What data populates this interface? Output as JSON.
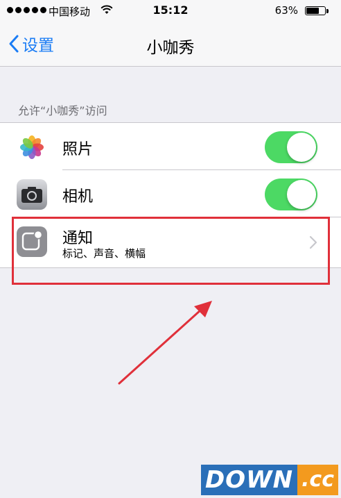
{
  "status_bar": {
    "carrier": "中国移动",
    "time": "15:12",
    "battery_percent": "63%",
    "battery_level": 0.63
  },
  "nav": {
    "back_label": "设置",
    "title": "小咖秀"
  },
  "section": {
    "header": "允许“小咖秀”访问"
  },
  "rows": [
    {
      "label": "照片",
      "toggle_on": true,
      "icon": "photos-icon"
    },
    {
      "label": "相机",
      "toggle_on": true,
      "icon": "camera-icon"
    },
    {
      "label": "通知",
      "subtitle": "标记、声音、横幅",
      "icon": "notifications-icon"
    }
  ],
  "watermark": {
    "main": "DOWN",
    "suffix": ".cc"
  },
  "colors": {
    "accent": "#1a7cf5",
    "toggle_on": "#4cd964",
    "annotation": "#e0303a"
  }
}
